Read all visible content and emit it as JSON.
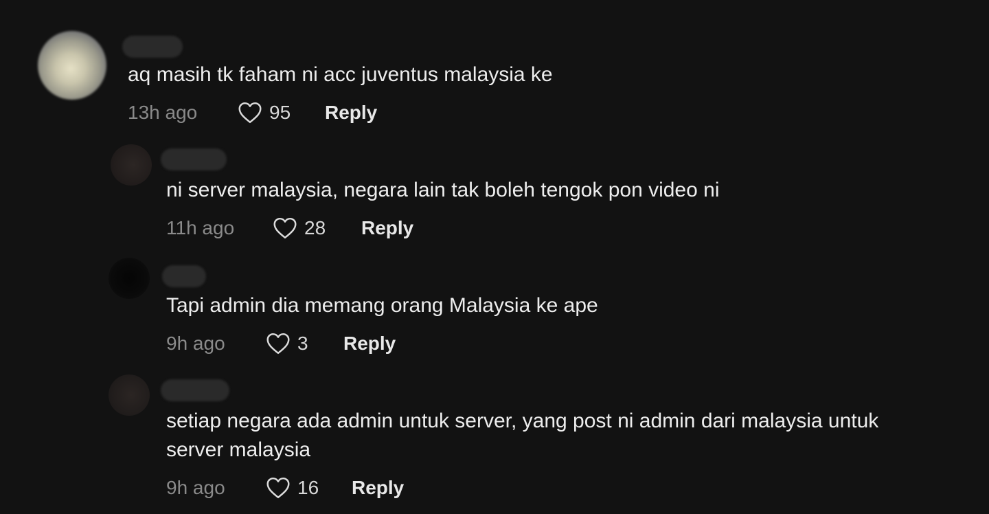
{
  "comments": [
    {
      "text": "aq masih tk faham ni acc juventus malaysia ke",
      "time": "13h ago",
      "likes": "95",
      "reply_label": "Reply"
    },
    {
      "text": "ni server malaysia, negara lain tak boleh tengok pon video ni",
      "time": "11h ago",
      "likes": "28",
      "reply_label": "Reply"
    },
    {
      "text": "Tapi admin dia memang orang Malaysia ke ape",
      "time": "9h ago",
      "likes": "3",
      "reply_label": "Reply"
    },
    {
      "text": "setiap negara ada admin untuk server, yang post ni admin dari malaysia untuk server malaysia",
      "time": "9h ago",
      "likes": "16",
      "reply_label": "Reply"
    }
  ],
  "colors": {
    "background": "#121212",
    "text": "#ededed",
    "muted": "#8a8a8a"
  },
  "icons": {
    "like": "heart-outline-icon"
  }
}
